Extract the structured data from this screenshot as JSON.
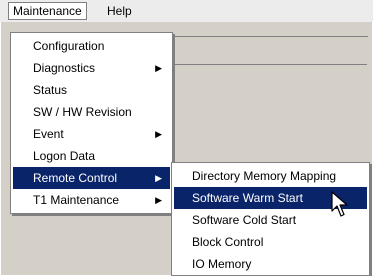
{
  "menubar": {
    "items": [
      "Maintenance",
      "Help"
    ]
  },
  "maintenance_menu": {
    "items": [
      {
        "label": "Configuration",
        "submenu": false
      },
      {
        "label": "Diagnostics",
        "submenu": true
      },
      {
        "label": "Status",
        "submenu": false
      },
      {
        "label": "SW / HW Revision",
        "submenu": false
      },
      {
        "label": "Event",
        "submenu": true
      },
      {
        "label": "Logon Data",
        "submenu": false
      },
      {
        "label": "Remote Control",
        "submenu": true,
        "highlighted": true
      },
      {
        "label": "T1 Maintenance",
        "submenu": true
      }
    ]
  },
  "remote_control_menu": {
    "items": [
      {
        "label": "Directory Memory Mapping"
      },
      {
        "label": "Software Warm Start",
        "highlighted": true
      },
      {
        "label": "Software Cold Start"
      },
      {
        "label": "Block Control"
      },
      {
        "label": "IO Memory"
      }
    ]
  },
  "colors": {
    "highlight": "#0a246a",
    "menu_bg": "#ffffff",
    "window_bg": "#d4d0c8"
  },
  "icons": {
    "submenu_arrow": "triangle-right-icon",
    "cursor": "mouse-pointer-icon"
  }
}
